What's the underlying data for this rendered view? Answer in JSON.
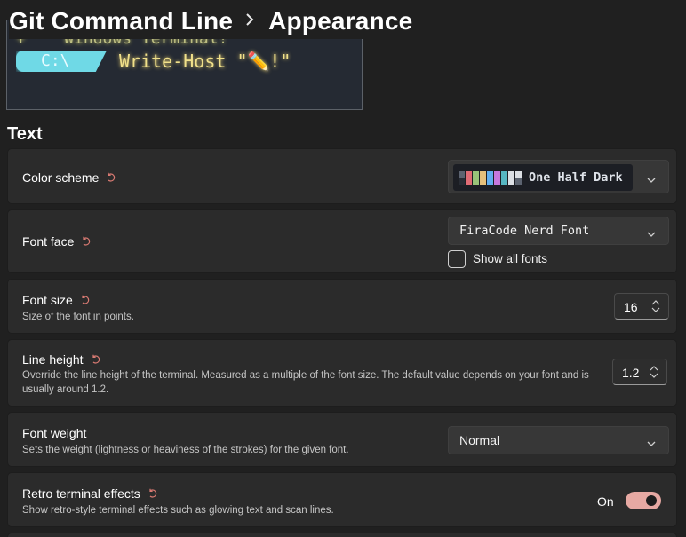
{
  "header": {
    "parent": "Git Command Line",
    "current": "Appearance"
  },
  "preview": {
    "line1": "+    Windows Terminal!",
    "prompt": "C:\\",
    "command": "Write-Host \"✏️!\""
  },
  "section": {
    "title": "Text"
  },
  "settings": {
    "color_scheme": {
      "label": "Color scheme",
      "value": "One Half Dark",
      "swatches": [
        "#5c6370",
        "#e06c75",
        "#98c379",
        "#e5c07b",
        "#61afef",
        "#c678dd",
        "#56b6c2",
        "#dcdfe4",
        "#dcdfe4",
        "#282c34",
        "#e06c75",
        "#98c379",
        "#e5c07b",
        "#61afef",
        "#c678dd",
        "#56b6c2",
        "#dcdfe4",
        "#5c6370"
      ]
    },
    "font_face": {
      "label": "Font face",
      "value": "FiraCode Nerd Font",
      "show_all_label": "Show all fonts",
      "show_all_checked": false
    },
    "font_size": {
      "label": "Font size",
      "description": "Size of the font in points.",
      "value": "16"
    },
    "line_height": {
      "label": "Line height",
      "description": "Override the line height of the terminal. Measured as a multiple of the font size. The default value depends on your font and is usually around 1.2.",
      "value": "1.2"
    },
    "font_weight": {
      "label": "Font weight",
      "description": "Sets the weight (lightness or heaviness of the strokes) for the given font.",
      "value": "Normal"
    },
    "retro": {
      "label": "Retro terminal effects",
      "description": "Show retro-style terminal effects such as glowing text and scan lines.",
      "state_label": "On",
      "on": true
    }
  },
  "colors": {
    "accent": "#e7a9a3",
    "reset_icon": "#d87a72",
    "background": "#202020",
    "card": "#2b2b2b"
  },
  "icons": [
    "chevron-right-icon",
    "reset-icon",
    "chevron-down-icon",
    "spin-arrows-icon"
  ]
}
